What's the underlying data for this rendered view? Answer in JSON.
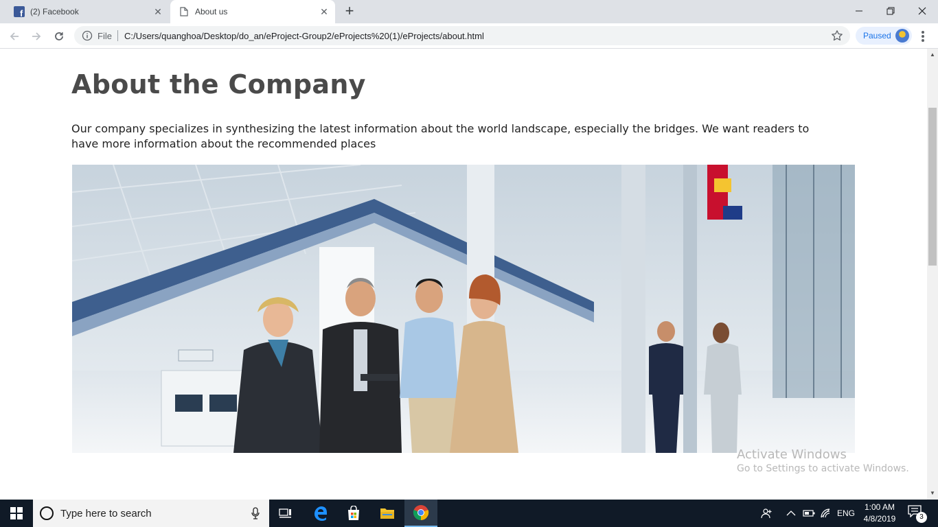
{
  "browser": {
    "tabs": [
      {
        "title": "(2) Facebook",
        "icon": "facebook-icon",
        "active": false
      },
      {
        "title": "About us",
        "icon": "page-icon",
        "active": true
      }
    ],
    "address": {
      "scheme_label": "File",
      "url": "C:/Users/quanghoa/Desktop/do_an/eProject-Group2/eProjects%20(1)/eProjects/about.html"
    },
    "profile_status": "Paused"
  },
  "page": {
    "title": "About the Company",
    "description": "Our company specializes in synthesizing the latest information about the world landscape, especially the bridges. We want readers to have more information about the recommended places"
  },
  "watermark": {
    "line1": "Activate Windows",
    "line2": "Go to Settings to activate Windows."
  },
  "taskbar": {
    "search_placeholder": "Type here to search",
    "language": "ENG",
    "time": "1:00 AM",
    "date": "4/8/2019",
    "notification_count": "3"
  },
  "colors": {
    "accent": "#1a73e8",
    "facebook": "#3b5998",
    "taskbar": "#101a27",
    "title_text": "#4a4a4a"
  }
}
